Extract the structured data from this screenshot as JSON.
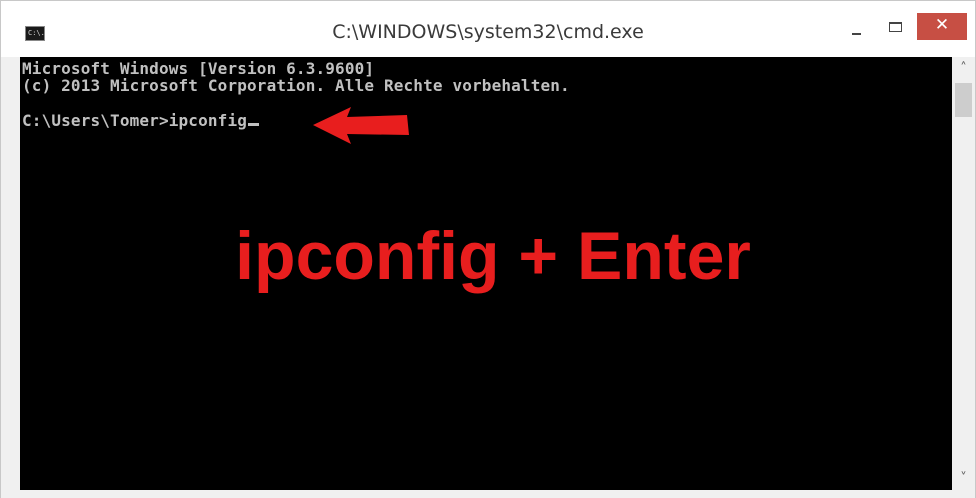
{
  "window": {
    "title": "C:\\WINDOWS\\system32\\cmd.exe",
    "app_icon_text": "C:\\.",
    "minimize_symbol": "",
    "close_symbol": "✕"
  },
  "console": {
    "lines": [
      "Microsoft Windows [Version 6.3.9600]",
      "(c) 2013 Microsoft Corporation. Alle Rechte vorbehalten.",
      "",
      "C:\\Users\\Tomer>ipconfig"
    ],
    "text_color": "#c0c0c0",
    "background_color": "#000000"
  },
  "annotation": {
    "text": "ipconfig + Enter",
    "color": "#e81e1e",
    "arrow_icon": "left-arrow-icon"
  },
  "scrollbar": {
    "up_symbol": "˄",
    "down_symbol": "˅"
  }
}
